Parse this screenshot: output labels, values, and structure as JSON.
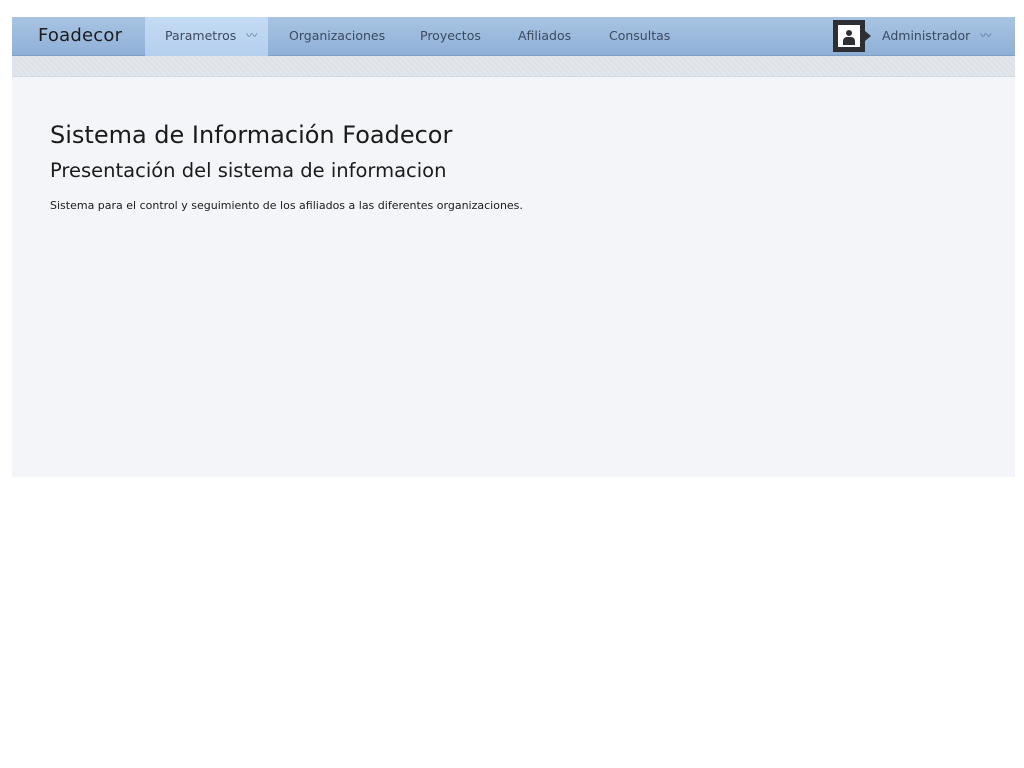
{
  "navbar": {
    "brand": "Foadecor",
    "items": [
      {
        "label": "Parametros",
        "active": true,
        "has_dropdown": true
      },
      {
        "label": "Organizaciones",
        "active": false,
        "has_dropdown": false
      },
      {
        "label": "Proyectos",
        "active": false,
        "has_dropdown": false
      },
      {
        "label": "Afiliados",
        "active": false,
        "has_dropdown": false
      },
      {
        "label": "Consultas",
        "active": false,
        "has_dropdown": false
      }
    ],
    "user": {
      "name": "Administrador",
      "avatar_icon": "user-silhouette-icon",
      "has_dropdown": true
    },
    "dropdown_icon": "chevron-down-icon"
  },
  "main": {
    "title": "Sistema de Información Foadecor",
    "subtitle": "Presentación del sistema de informacion",
    "description": "Sistema para el control y seguimiento de los afiliados a las diferentes organizaciones."
  },
  "colors": {
    "navbar_bg": "#9ebbe0",
    "nav_active_bg": "#bcd5f1",
    "content_bg": "#f3f5f8"
  }
}
